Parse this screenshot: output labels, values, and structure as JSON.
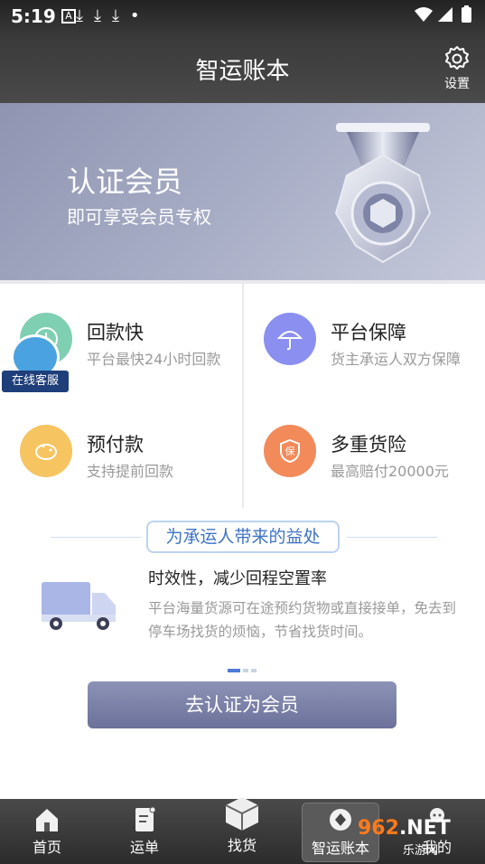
{
  "status_bar": {
    "time": "5:19",
    "icons": [
      "a-icon",
      "download-icon",
      "download-icon",
      "download-icon",
      "dot-icon",
      "wifi-icon",
      "signal-icon",
      "battery-icon"
    ]
  },
  "header": {
    "title": "智运账本",
    "settings_label": "设置"
  },
  "banner": {
    "title": "认证会员",
    "subtitle": "即可享受会员专权"
  },
  "features": [
    {
      "title": "回款快",
      "desc": "平台最快24小时回款",
      "icon": "clock-icon",
      "color": "#7fcfb2"
    },
    {
      "title": "平台保障",
      "desc": "货主承运人双方保障",
      "icon": "umbrella-icon",
      "color": "#8a8ff0"
    },
    {
      "title": "预付款",
      "desc": "支持提前回款",
      "icon": "piggy-bank-icon",
      "color": "#f6c460"
    },
    {
      "title": "多重货险",
      "desc": "最高赔付20000元",
      "icon": "insurance-icon",
      "color": "#f28a5a"
    }
  ],
  "floating_service": {
    "label": "在线客服"
  },
  "benefits": {
    "title": "为承运人带来的益处",
    "headline": "时效性，减少回程空置率",
    "body": "平台海量货源可在途预约货物或直接接单，免去到停车场找货的烦恼，节省找货时间。",
    "pages": 3,
    "active_page": 1
  },
  "cta": {
    "label": "去认证为会员"
  },
  "nav": [
    {
      "label": "首页",
      "icon": "home-icon"
    },
    {
      "label": "运单",
      "icon": "waybill-icon"
    },
    {
      "label": "找货",
      "icon": "cargo-box-icon"
    },
    {
      "label": "智运账本",
      "icon": "ledger-icon",
      "active": true
    },
    {
      "label": "我的",
      "icon": "profile-icon"
    }
  ],
  "watermark": {
    "text_orange": "962",
    "text_white": ".NET",
    "sub": "乐游网"
  }
}
